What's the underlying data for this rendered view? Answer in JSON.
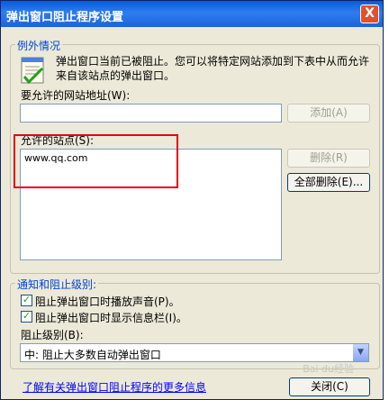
{
  "window": {
    "title": "弹出窗口阻止程序设置",
    "close_label": "X"
  },
  "exceptions": {
    "legend": "例外情况",
    "info": "弹出窗口当前已被阻止。您可以将特定网站添加到下表中从而允许来自该站点的弹出窗口。",
    "address_label": "要允许的网站地址(W):",
    "address_value": "",
    "add_button": "添加(A)",
    "allowed_label": "允许的站点(S):",
    "allowed_sites": [
      "www.qq.com"
    ],
    "remove_button": "删除(R)",
    "remove_all_button": "全部删除(E)..."
  },
  "notification": {
    "legend": "通知和阻止级别:",
    "play_sound": {
      "label": "阻止弹出窗口时播放声音(P)。",
      "checked": true
    },
    "show_bar": {
      "label": "阻止弹出窗口时显示信息栏(I)。",
      "checked": true
    },
    "level_label": "阻止级别(B):",
    "level_value": "中: 阻止大多数自动弹出窗口"
  },
  "footer": {
    "learn_more_link": "了解有关弹出窗口阻止程序的更多信息",
    "close_button": "关闭(C)"
  },
  "watermark": "Bai du经验"
}
